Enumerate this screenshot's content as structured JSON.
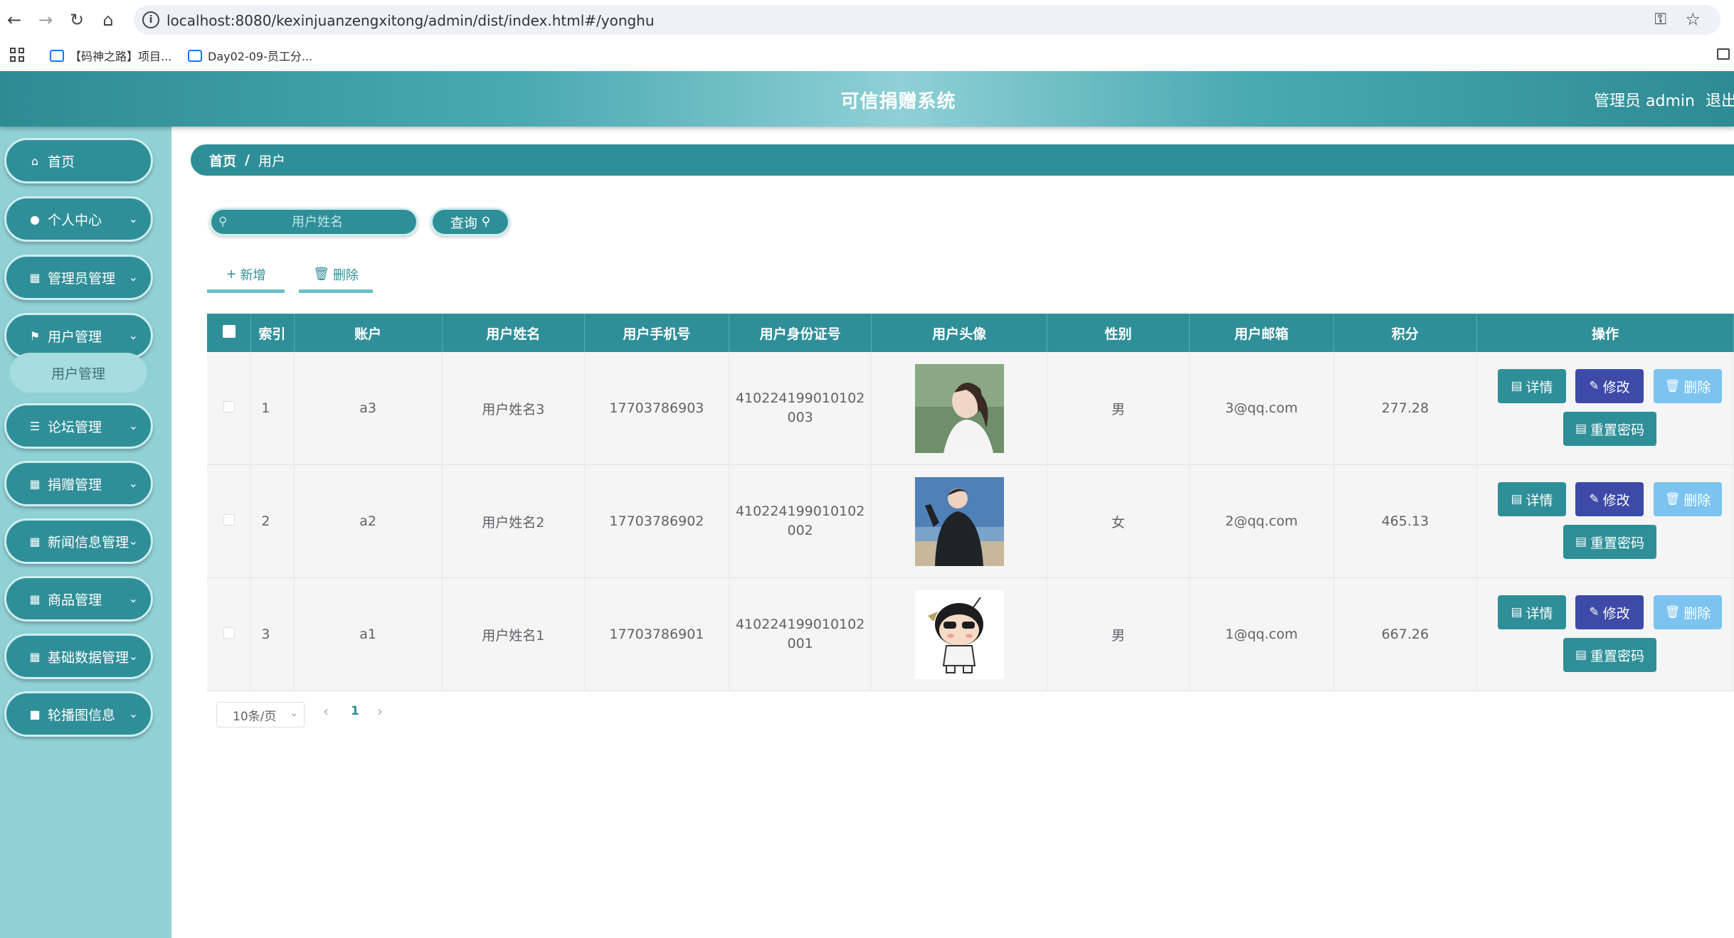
{
  "browser": {
    "url": "localhost:8080/kexinjuanzengxitong/admin/dist/index.html#/yonghu",
    "bookmarks": [
      "【码神之路】项目...",
      "Day02-09-员工分..."
    ]
  },
  "header": {
    "title": "可信捐赠系统",
    "admin_label": "管理员 admin",
    "logout_label": "退出"
  },
  "sidebar": {
    "items": [
      {
        "label": "首页",
        "icon": "home-icon"
      },
      {
        "label": "个人中心",
        "icon": "user-icon"
      },
      {
        "label": "管理员管理",
        "icon": "grid-icon"
      },
      {
        "label": "用户管理",
        "icon": "flag-icon"
      },
      {
        "label": "论坛管理",
        "icon": "sliders-icon"
      },
      {
        "label": "捐赠管理",
        "icon": "grid-icon"
      },
      {
        "label": "新闻信息管理",
        "icon": "grid-icon"
      },
      {
        "label": "商品管理",
        "icon": "grid-icon"
      },
      {
        "label": "基础数据管理",
        "icon": "grid-icon"
      },
      {
        "label": "轮播图信息",
        "icon": "book-icon"
      }
    ],
    "submenu_label": "用户管理"
  },
  "breadcrumb": {
    "home": "首页",
    "separator": "/",
    "current": "用户"
  },
  "search": {
    "placeholder": "用户姓名",
    "button_label": "查询"
  },
  "toolbar": {
    "add_label": "新增",
    "delete_label": "删除"
  },
  "table": {
    "headers": [
      "索引",
      "账户",
      "用户姓名",
      "用户手机号",
      "用户身份证号",
      "用户头像",
      "性别",
      "用户邮箱",
      "积分",
      "操作"
    ],
    "rows": [
      {
        "index": "1",
        "account": "a3",
        "name": "用户姓名3",
        "phone": "17703786903",
        "id_number": "410224199010102003",
        "gender": "男",
        "email": "3@qq.com",
        "points": "277.28",
        "avatar": "girl-photo"
      },
      {
        "index": "2",
        "account": "a2",
        "name": "用户姓名2",
        "phone": "17703786902",
        "id_number": "410224199010102002",
        "gender": "女",
        "email": "2@qq.com",
        "points": "465.13",
        "avatar": "boy-photo"
      },
      {
        "index": "3",
        "account": "a1",
        "name": "用户姓名1",
        "phone": "17703786901",
        "id_number": "410224199010102001",
        "gender": "男",
        "email": "1@qq.com",
        "points": "667.26",
        "avatar": "cartoon-avatar"
      }
    ],
    "actions": {
      "detail": "详情",
      "edit": "修改",
      "delete": "删除",
      "reset": "重置密码"
    }
  },
  "pagination": {
    "page_size": "10条/页",
    "current_page": "1"
  },
  "colors": {
    "primary": "#2f8f98",
    "sidebar_bg": "#90d1d6",
    "edit_button": "#3d4aa8",
    "delete_button": "#7cc3f0"
  }
}
